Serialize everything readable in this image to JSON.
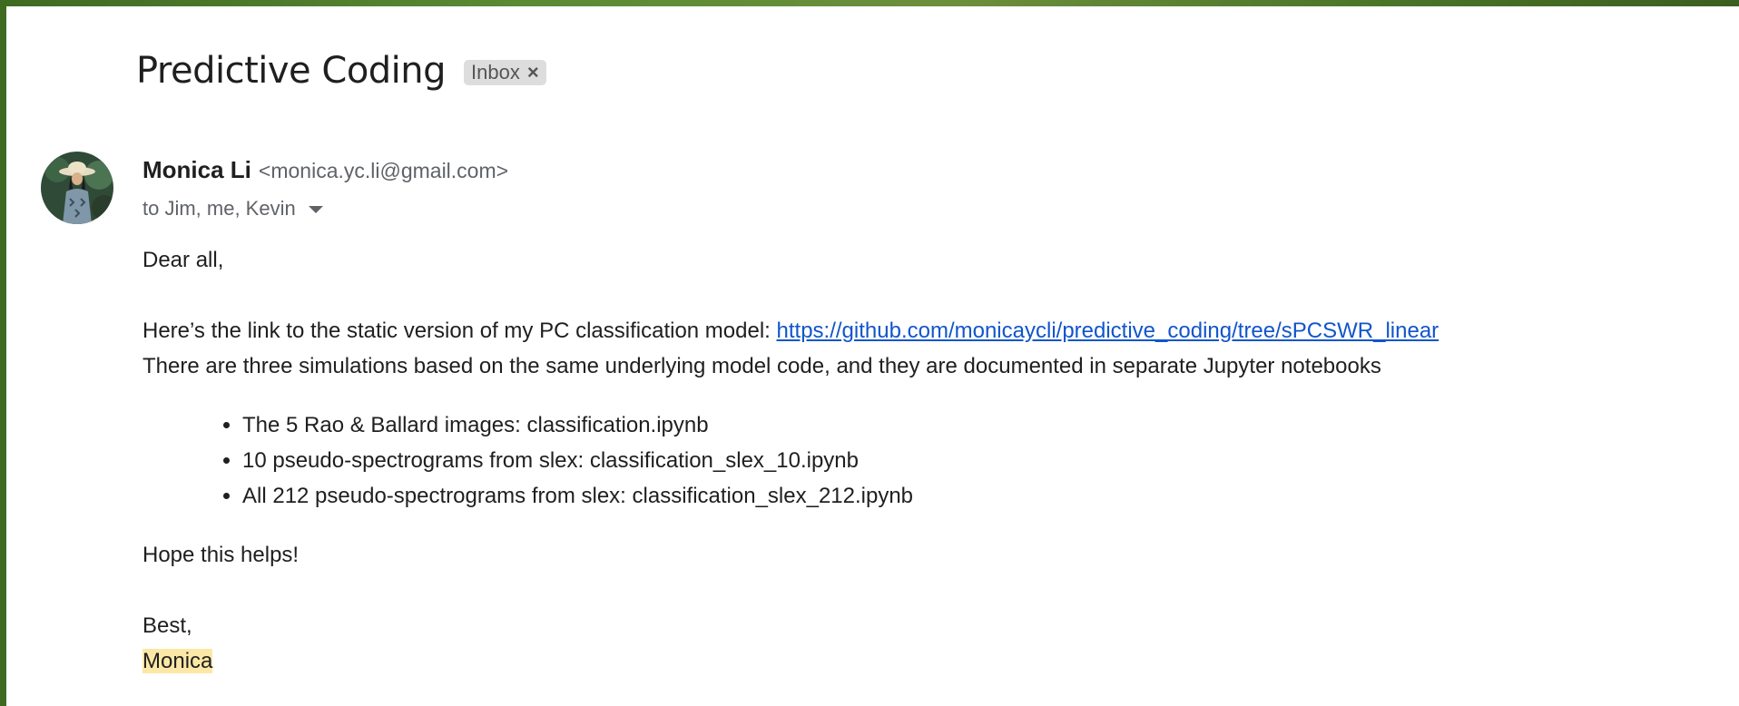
{
  "email": {
    "subject": "Predictive Coding",
    "label": "Inbox",
    "label_close": "×",
    "sender": {
      "name": "Monica Li",
      "email": "<monica.yc.li@gmail.com>"
    },
    "recipients": "to Jim, me, Kevin",
    "body": {
      "greeting": "Dear all,",
      "intro": "Here’s the link to the static version of my PC classification model: ",
      "link": "https://github.com/monicaycli/predictive_coding/tree/sPCSWR_linear",
      "description": "There are three simulations based on the same underlying model code, and they are documented in separate Jupyter notebooks",
      "items": [
        "The 5 Rao & Ballard images: classification.ipynb",
        "10 pseudo-spectrograms from slex: classification_slex_10.ipynb",
        "All 212 pseudo-spectrograms from slex: classification_slex_212.ipynb"
      ],
      "closing": "Hope this helps!",
      "signoff": "Best,",
      "signature": "Monica"
    }
  },
  "colors": {
    "link": "#1155cc",
    "highlight": "#fce8a6",
    "chip": "#dddddd"
  },
  "icons": {
    "avatar": "avatar-photo",
    "recipients_dropdown": "caret-down-icon"
  }
}
